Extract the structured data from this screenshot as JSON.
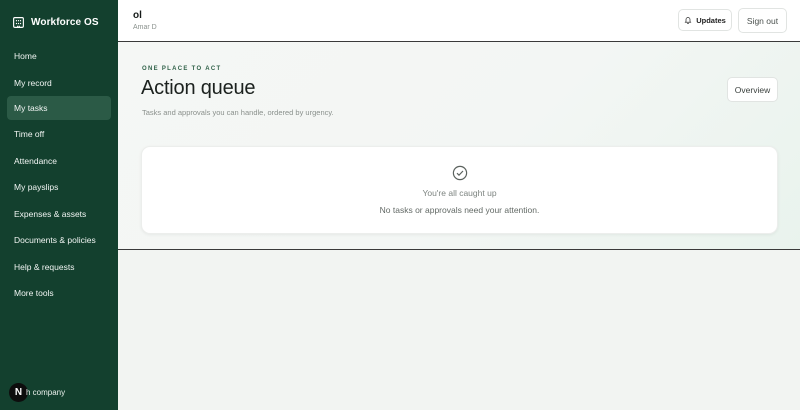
{
  "app": {
    "name": "Workforce OS"
  },
  "sidebar": {
    "items": [
      {
        "label": "Home"
      },
      {
        "label": "My record"
      },
      {
        "label": "My tasks",
        "active": true
      },
      {
        "label": "Time off"
      },
      {
        "label": "Attendance"
      },
      {
        "label": "My payslips"
      },
      {
        "label": "Expenses & assets"
      },
      {
        "label": "Documents & policies"
      },
      {
        "label": "Help & requests"
      },
      {
        "label": "More tools"
      }
    ],
    "footer": {
      "badge": "N",
      "company": "h company"
    }
  },
  "topbar": {
    "user_name": "ol",
    "user_sub": "Amar D",
    "updates_label": "Updates",
    "signout_label": "Sign out",
    "updates_icon": "bell-icon"
  },
  "main": {
    "eyebrow": "ONE PLACE TO ACT",
    "title": "Action queue",
    "subtitle": "Tasks and approvals you can handle, ordered by urgency.",
    "overview_label": "Overview",
    "empty_state": {
      "icon": "check-circle-icon",
      "title": "You're all caught up",
      "subtitle": "No tasks or approvals need your attention."
    }
  },
  "colors": {
    "sidebar_bg": "#13402e",
    "sidebar_active": "#2b5a46",
    "accent_text": "#2f6148",
    "page_bg": "#f2f4f2"
  }
}
